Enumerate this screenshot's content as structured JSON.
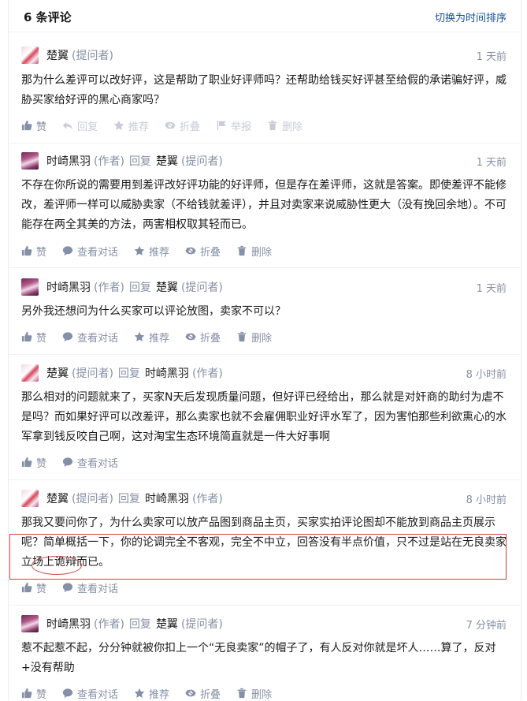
{
  "header": {
    "count_label": "6 条评论",
    "sort_label": "切换为时间排序"
  },
  "labels": {
    "like": "赞",
    "reply": "回复",
    "recommend": "推荐",
    "fold": "折叠",
    "report": "举报",
    "delete": "删除",
    "view_conversation": "查看对话",
    "reply_word": "回复"
  },
  "comments": [
    {
      "author": "楚翼",
      "role": "(提问者)",
      "time": "1 天前",
      "text": "那为什么差评可以改好评，这是帮助了职业好评师吗？还帮助给钱买好评甚至给假的承诺骗好评，威胁买家给好评的黑心商家吗？"
    },
    {
      "author": "时崎黑羽",
      "role": "(作者)",
      "reply_to": "楚翼",
      "reply_to_role": "(提问者)",
      "time": "1 天前",
      "text": "不存在你所说的需要用到差评改好评功能的好评师，但是存在差评师，这就是答案。即使差评不能修改，差评师一样可以威胁卖家（不给钱就差评），并且对卖家来说威胁性更大（没有挽回余地）。不可能存在两全其美的方法，两害相权取其轻而已。"
    },
    {
      "author": "时崎黑羽",
      "role": "(作者)",
      "reply_to": "楚翼",
      "reply_to_role": "(提问者)",
      "time": "1 天前",
      "text": "另外我还想问为什么买家可以评论放图，卖家不可以？"
    },
    {
      "author": "楚翼",
      "role": "(提问者)",
      "reply_to": "时崎黑羽",
      "reply_to_role": "(作者)",
      "time": "8 小时前",
      "text": "那么相对的问题就来了，买家N天后发现质量问题，但好评已经给出，那么就是对奸商的助纣为虐不是吗？而如果好评可以改差评，那么卖家也就不会雇佣职业好评水军了，因为害怕那些利欲熏心的水军拿到钱反咬自己啊，这对淘宝生态环境简直就是一件大好事啊"
    },
    {
      "author": "楚翼",
      "role": "(提问者)",
      "reply_to": "时崎黑羽",
      "reply_to_role": "(作者)",
      "time": "8 小时前",
      "text": "那我又要问你了，为什么卖家可以放产品图到商品主页，买家实拍评论图却不能放到商品主页展示呢？简单概括一下，你的论调完全不客观，完全不中立，回答没有半点价值，只不过是站在无良卖家立场上诡辩而已。"
    },
    {
      "author": "时崎黑羽",
      "role": "(作者)",
      "reply_to": "楚翼",
      "reply_to_role": "(提问者)",
      "time": "7 分钟前",
      "text": "惹不起惹不起，分分钟就被你扣上一个“无良卖家”的帽子了，有人反对你就是坏人……算了，反对+没有帮助"
    }
  ],
  "icons": [
    "thumbs-up-icon",
    "reply-arrow-icon",
    "star-icon",
    "fold-eye-icon",
    "flag-icon",
    "trash-icon",
    "chat-bubble-icon"
  ],
  "colors": {
    "link": "#175199",
    "meta_gray": "#8590a6",
    "faded": "#c7ccd6",
    "annotation_red": "#d43b3b"
  }
}
